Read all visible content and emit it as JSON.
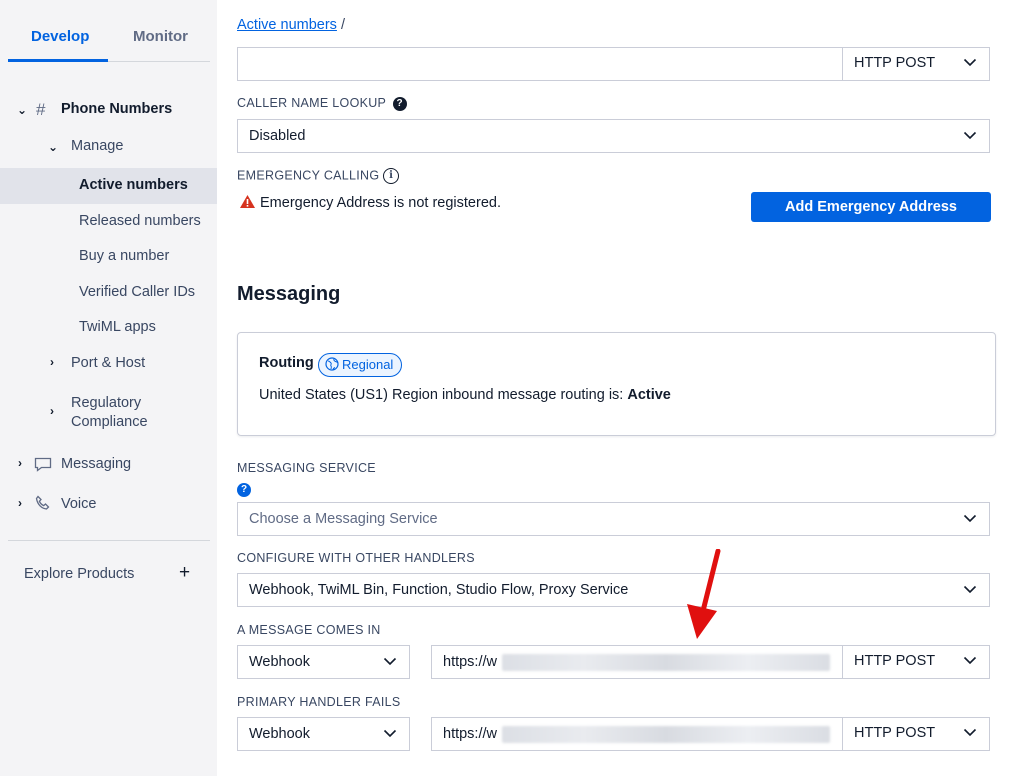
{
  "sidebar": {
    "tabs": [
      {
        "label": "Develop"
      },
      {
        "label": "Monitor"
      }
    ],
    "phone_numbers": "Phone Numbers",
    "manage": "Manage",
    "items": [
      {
        "label": "Active numbers"
      },
      {
        "label": "Released numbers"
      },
      {
        "label": "Buy a number"
      },
      {
        "label": "Verified Caller IDs"
      },
      {
        "label": "TwiML apps"
      }
    ],
    "port_host": "Port & Host",
    "regulatory_line1": "Regulatory",
    "regulatory_line2": "Compliance",
    "messaging": "Messaging",
    "voice": "Voice",
    "explore": "Explore Products",
    "explore_plus": "+"
  },
  "breadcrumb": {
    "link": "Active numbers",
    "separator": "/"
  },
  "top_method": "HTTP POST",
  "caller_name_lookup": {
    "label": "CALLER NAME LOOKUP",
    "value": "Disabled"
  },
  "emergency": {
    "label": "EMERGENCY CALLING",
    "warning": "Emergency Address is not registered.",
    "button": "Add Emergency Address"
  },
  "messaging": {
    "heading": "Messaging",
    "routing_title": "Routing",
    "routing_badge": "Regional",
    "routing_text": "United States (US1) Region inbound message routing is: ",
    "routing_status": "Active",
    "service_label": "MESSAGING SERVICE",
    "service_placeholder": "Choose a Messaging Service",
    "handlers_label": "CONFIGURE WITH OTHER HANDLERS",
    "handlers_value": "Webhook, TwiML Bin, Function, Studio Flow, Proxy Service",
    "comes_in_label": "A MESSAGE COMES IN",
    "comes_in_type": "Webhook",
    "comes_in_url": "https://w",
    "comes_in_method": "HTTP POST",
    "fails_label": "PRIMARY HANDLER FAILS",
    "fails_type": "Webhook",
    "fails_url": "https://w",
    "fails_method": "HTTP POST"
  },
  "colors": {
    "accent": "#0263e0",
    "warning": "#d6331f",
    "annotation": "#e0100f"
  }
}
